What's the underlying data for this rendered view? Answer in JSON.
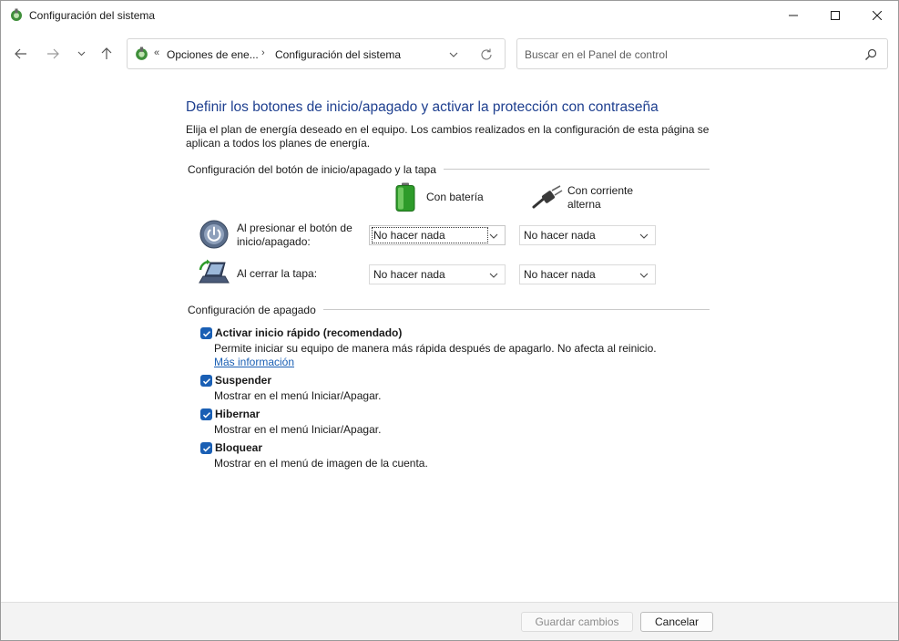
{
  "window": {
    "title": "Configuración del sistema",
    "icon": "power-options-icon"
  },
  "nav": {
    "back_icon": "arrow-left-icon",
    "forward_icon": "arrow-right-icon",
    "recent_icon": "chevron-down-icon",
    "up_icon": "arrow-up-icon"
  },
  "address": {
    "chevron": "«",
    "crumbs": [
      "Opciones de ene...",
      "Configuración del sistema"
    ],
    "separator": "›"
  },
  "search": {
    "placeholder": "Buscar en el Panel de control"
  },
  "main": {
    "title": "Definir los botones de inicio/apagado y activar la protección con contraseña",
    "intro": "Elija el plan de energía deseado en el equipo. Los cambios realizados en la configuración de esta página se aplican a todos los planes de energía."
  },
  "buttons_section": {
    "heading": "Configuración del botón de inicio/apagado y la tapa",
    "col_battery": "Con batería",
    "col_ac": "Con corriente alterna",
    "rows": [
      {
        "label": "Al presionar el botón de inicio/apagado:",
        "battery": "No hacer nada",
        "ac": "No hacer nada"
      },
      {
        "label": "Al cerrar la tapa:",
        "battery": "No hacer nada",
        "ac": "No hacer nada"
      }
    ]
  },
  "shutdown_section": {
    "heading": "Configuración de apagado",
    "items": [
      {
        "label": "Activar inicio rápido (recomendado)",
        "desc": "Permite iniciar su equipo de manera más rápida después de apagarlo. No afecta al reinicio. ",
        "link": "Más información",
        "checked": true
      },
      {
        "label": "Suspender",
        "desc": "Mostrar en el menú Iniciar/Apagar.",
        "checked": true
      },
      {
        "label": "Hibernar",
        "desc": "Mostrar en el menú Iniciar/Apagar.",
        "checked": true
      },
      {
        "label": "Bloquear",
        "desc": "Mostrar en el menú de imagen de la cuenta.",
        "checked": true
      }
    ]
  },
  "footer": {
    "save": "Guardar cambios",
    "cancel": "Cancelar"
  },
  "colors": {
    "accent": "#1a5fb4",
    "title": "#1e3f8f"
  }
}
